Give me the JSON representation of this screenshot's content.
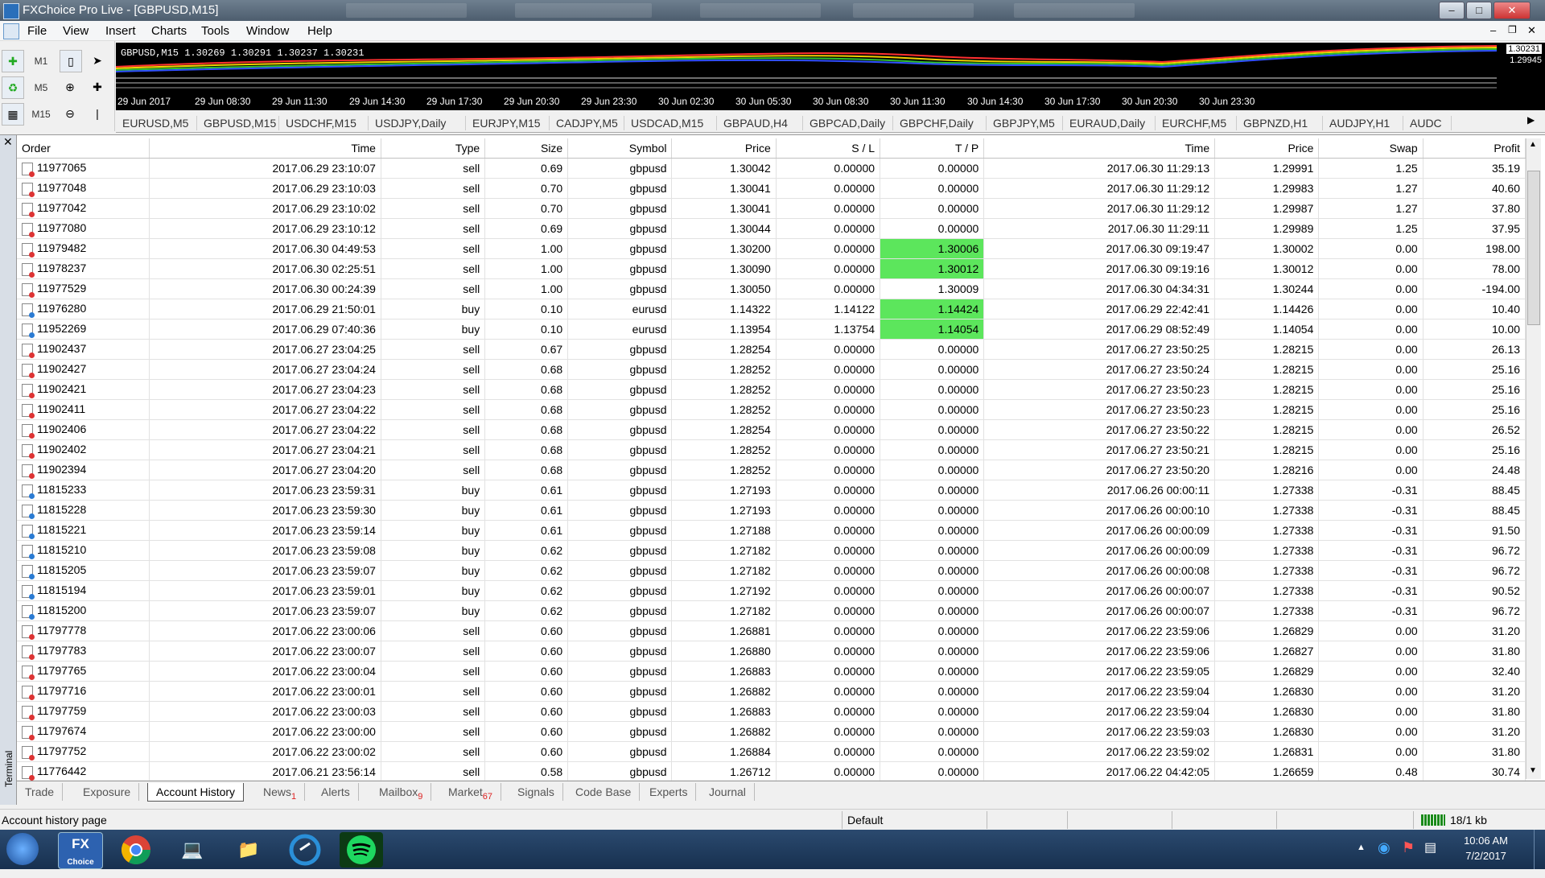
{
  "window": {
    "title": "FXChoice Pro Live - [GBPUSD,M15]"
  },
  "menu": [
    "File",
    "View",
    "Insert",
    "Charts",
    "Tools",
    "Window",
    "Help"
  ],
  "toolbar": {
    "tf1": "M1",
    "tf2": "M5",
    "tf3": "M15"
  },
  "chart": {
    "info": "GBPUSD,M15  1.30269 1.30291 1.30237 1.30231",
    "price_high": "1.30231",
    "price_low": "1.29945",
    "time_ticks": [
      "29 Jun 2017",
      "29 Jun 08:30",
      "29 Jun 11:30",
      "29 Jun 14:30",
      "29 Jun 17:30",
      "29 Jun 20:30",
      "29 Jun 23:30",
      "30 Jun 02:30",
      "30 Jun 05:30",
      "30 Jun 08:30",
      "30 Jun 11:30",
      "30 Jun 14:30",
      "30 Jun 17:30",
      "30 Jun 20:30",
      "30 Jun 23:30"
    ]
  },
  "symbol_tabs": [
    "EURUSD,M5",
    "GBPUSD,M15",
    "USDCHF,M15",
    "USDJPY,Daily",
    "EURJPY,M15",
    "CADJPY,M5",
    "USDCAD,M15",
    "GBPAUD,H4",
    "GBPCAD,Daily",
    "GBPCHF,Daily",
    "GBPJPY,M5",
    "EURAUD,Daily",
    "EURCHF,M5",
    "GBPNZD,H1",
    "AUDJPY,H1",
    "AUDC"
  ],
  "table": {
    "headers": [
      "Order",
      "Time",
      "Type",
      "Size",
      "Symbol",
      "Price",
      "S / L",
      "T / P",
      "Time",
      "Price",
      "Swap",
      "Profit"
    ],
    "rows": [
      [
        "11977065",
        "2017.06.29 23:10:07",
        "sell",
        "0.69",
        "gbpusd",
        "1.30042",
        "0.00000",
        "0.00000",
        "2017.06.30 11:29:13",
        "1.29991",
        "1.25",
        "35.19"
      ],
      [
        "11977048",
        "2017.06.29 23:10:03",
        "sell",
        "0.70",
        "gbpusd",
        "1.30041",
        "0.00000",
        "0.00000",
        "2017.06.30 11:29:12",
        "1.29983",
        "1.27",
        "40.60"
      ],
      [
        "11977042",
        "2017.06.29 23:10:02",
        "sell",
        "0.70",
        "gbpusd",
        "1.30041",
        "0.00000",
        "0.00000",
        "2017.06.30 11:29:12",
        "1.29987",
        "1.27",
        "37.80"
      ],
      [
        "11977080",
        "2017.06.29 23:10:12",
        "sell",
        "0.69",
        "gbpusd",
        "1.30044",
        "0.00000",
        "0.00000",
        "2017.06.30 11:29:11",
        "1.29989",
        "1.25",
        "37.95"
      ],
      [
        "11979482",
        "2017.06.30 04:49:53",
        "sell",
        "1.00",
        "gbpusd",
        "1.30200",
        "0.00000",
        "1.30006",
        "2017.06.30 09:19:47",
        "1.30002",
        "0.00",
        "198.00"
      ],
      [
        "11978237",
        "2017.06.30 02:25:51",
        "sell",
        "1.00",
        "gbpusd",
        "1.30090",
        "0.00000",
        "1.30012",
        "2017.06.30 09:19:16",
        "1.30012",
        "0.00",
        "78.00"
      ],
      [
        "11977529",
        "2017.06.30 00:24:39",
        "sell",
        "1.00",
        "gbpusd",
        "1.30050",
        "0.00000",
        "1.30009",
        "2017.06.30 04:34:31",
        "1.30244",
        "0.00",
        "-194.00"
      ],
      [
        "11976280",
        "2017.06.29 21:50:01",
        "buy",
        "0.10",
        "eurusd",
        "1.14322",
        "1.14122",
        "1.14424",
        "2017.06.29 22:42:41",
        "1.14426",
        "0.00",
        "10.40"
      ],
      [
        "11952269",
        "2017.06.29 07:40:36",
        "buy",
        "0.10",
        "eurusd",
        "1.13954",
        "1.13754",
        "1.14054",
        "2017.06.29 08:52:49",
        "1.14054",
        "0.00",
        "10.00"
      ],
      [
        "11902437",
        "2017.06.27 23:04:25",
        "sell",
        "0.67",
        "gbpusd",
        "1.28254",
        "0.00000",
        "0.00000",
        "2017.06.27 23:50:25",
        "1.28215",
        "0.00",
        "26.13"
      ],
      [
        "11902427",
        "2017.06.27 23:04:24",
        "sell",
        "0.68",
        "gbpusd",
        "1.28252",
        "0.00000",
        "0.00000",
        "2017.06.27 23:50:24",
        "1.28215",
        "0.00",
        "25.16"
      ],
      [
        "11902421",
        "2017.06.27 23:04:23",
        "sell",
        "0.68",
        "gbpusd",
        "1.28252",
        "0.00000",
        "0.00000",
        "2017.06.27 23:50:23",
        "1.28215",
        "0.00",
        "25.16"
      ],
      [
        "11902411",
        "2017.06.27 23:04:22",
        "sell",
        "0.68",
        "gbpusd",
        "1.28252",
        "0.00000",
        "0.00000",
        "2017.06.27 23:50:23",
        "1.28215",
        "0.00",
        "25.16"
      ],
      [
        "11902406",
        "2017.06.27 23:04:22",
        "sell",
        "0.68",
        "gbpusd",
        "1.28254",
        "0.00000",
        "0.00000",
        "2017.06.27 23:50:22",
        "1.28215",
        "0.00",
        "26.52"
      ],
      [
        "11902402",
        "2017.06.27 23:04:21",
        "sell",
        "0.68",
        "gbpusd",
        "1.28252",
        "0.00000",
        "0.00000",
        "2017.06.27 23:50:21",
        "1.28215",
        "0.00",
        "25.16"
      ],
      [
        "11902394",
        "2017.06.27 23:04:20",
        "sell",
        "0.68",
        "gbpusd",
        "1.28252",
        "0.00000",
        "0.00000",
        "2017.06.27 23:50:20",
        "1.28216",
        "0.00",
        "24.48"
      ],
      [
        "11815233",
        "2017.06.23 23:59:31",
        "buy",
        "0.61",
        "gbpusd",
        "1.27193",
        "0.00000",
        "0.00000",
        "2017.06.26 00:00:11",
        "1.27338",
        "-0.31",
        "88.45"
      ],
      [
        "11815228",
        "2017.06.23 23:59:30",
        "buy",
        "0.61",
        "gbpusd",
        "1.27193",
        "0.00000",
        "0.00000",
        "2017.06.26 00:00:10",
        "1.27338",
        "-0.31",
        "88.45"
      ],
      [
        "11815221",
        "2017.06.23 23:59:14",
        "buy",
        "0.61",
        "gbpusd",
        "1.27188",
        "0.00000",
        "0.00000",
        "2017.06.26 00:00:09",
        "1.27338",
        "-0.31",
        "91.50"
      ],
      [
        "11815210",
        "2017.06.23 23:59:08",
        "buy",
        "0.62",
        "gbpusd",
        "1.27182",
        "0.00000",
        "0.00000",
        "2017.06.26 00:00:09",
        "1.27338",
        "-0.31",
        "96.72"
      ],
      [
        "11815205",
        "2017.06.23 23:59:07",
        "buy",
        "0.62",
        "gbpusd",
        "1.27182",
        "0.00000",
        "0.00000",
        "2017.06.26 00:00:08",
        "1.27338",
        "-0.31",
        "96.72"
      ],
      [
        "11815194",
        "2017.06.23 23:59:01",
        "buy",
        "0.62",
        "gbpusd",
        "1.27192",
        "0.00000",
        "0.00000",
        "2017.06.26 00:00:07",
        "1.27338",
        "-0.31",
        "90.52"
      ],
      [
        "11815200",
        "2017.06.23 23:59:07",
        "buy",
        "0.62",
        "gbpusd",
        "1.27182",
        "0.00000",
        "0.00000",
        "2017.06.26 00:00:07",
        "1.27338",
        "-0.31",
        "96.72"
      ],
      [
        "11797778",
        "2017.06.22 23:00:06",
        "sell",
        "0.60",
        "gbpusd",
        "1.26881",
        "0.00000",
        "0.00000",
        "2017.06.22 23:59:06",
        "1.26829",
        "0.00",
        "31.20"
      ],
      [
        "11797783",
        "2017.06.22 23:00:07",
        "sell",
        "0.60",
        "gbpusd",
        "1.26880",
        "0.00000",
        "0.00000",
        "2017.06.22 23:59:06",
        "1.26827",
        "0.00",
        "31.80"
      ],
      [
        "11797765",
        "2017.06.22 23:00:04",
        "sell",
        "0.60",
        "gbpusd",
        "1.26883",
        "0.00000",
        "0.00000",
        "2017.06.22 23:59:05",
        "1.26829",
        "0.00",
        "32.40"
      ],
      [
        "11797716",
        "2017.06.22 23:00:01",
        "sell",
        "0.60",
        "gbpusd",
        "1.26882",
        "0.00000",
        "0.00000",
        "2017.06.22 23:59:04",
        "1.26830",
        "0.00",
        "31.20"
      ],
      [
        "11797759",
        "2017.06.22 23:00:03",
        "sell",
        "0.60",
        "gbpusd",
        "1.26883",
        "0.00000",
        "0.00000",
        "2017.06.22 23:59:04",
        "1.26830",
        "0.00",
        "31.80"
      ],
      [
        "11797674",
        "2017.06.22 23:00:00",
        "sell",
        "0.60",
        "gbpusd",
        "1.26882",
        "0.00000",
        "0.00000",
        "2017.06.22 23:59:03",
        "1.26830",
        "0.00",
        "31.20"
      ],
      [
        "11797752",
        "2017.06.22 23:00:02",
        "sell",
        "0.60",
        "gbpusd",
        "1.26884",
        "0.00000",
        "0.00000",
        "2017.06.22 23:59:02",
        "1.26831",
        "0.00",
        "31.80"
      ],
      [
        "11776442",
        "2017.06.21 23:56:14",
        "sell",
        "0.58",
        "gbpusd",
        "1.26712",
        "0.00000",
        "0.00000",
        "2017.06.22 04:42:05",
        "1.26659",
        "0.48",
        "30.74"
      ]
    ],
    "tp_highlight_color": "#5ce65c"
  },
  "terminal": {
    "side_label": "Terminal"
  },
  "bottom_tabs": [
    {
      "label": "Trade",
      "badge": ""
    },
    {
      "label": "Exposure",
      "badge": ""
    },
    {
      "label": "Account History",
      "badge": "",
      "active": true
    },
    {
      "label": "News",
      "badge": "1"
    },
    {
      "label": "Alerts",
      "badge": ""
    },
    {
      "label": "Mailbox",
      "badge": "9"
    },
    {
      "label": "Market",
      "badge": "67"
    },
    {
      "label": "Signals",
      "badge": ""
    },
    {
      "label": "Code Base",
      "badge": ""
    },
    {
      "label": "Experts",
      "badge": ""
    },
    {
      "label": "Journal",
      "badge": ""
    }
  ],
  "status": {
    "left": "Account history page",
    "profile": "Default",
    "connection": "18/1 kb"
  },
  "taskbar": {
    "time": "10:06 AM",
    "date": "7/2/2017",
    "fx_app_label": "FX",
    "fx_app_sub": "Choice"
  }
}
